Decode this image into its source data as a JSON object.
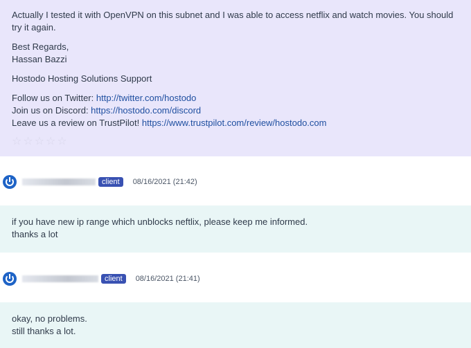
{
  "staff_reply": {
    "body": "Actually I tested it with OpenVPN on this subnet and I was able to access netflix and watch movies. You should try it again.",
    "regards": "Best Regards,",
    "signer": "Hassan Bazzi",
    "company": "Hostodo Hosting Solutions Support",
    "twitter_prefix": "Follow us on Twitter: ",
    "twitter_link": "http://twitter.com/hostodo",
    "discord_prefix": "Join us on Discord: ",
    "discord_link": "https://hostodo.com/discord",
    "review_prefix": "Leave us a review on TrustPilot! ",
    "review_link": "https://www.trustpilot.com/review/hostodo.com",
    "rating": {
      "value": 0,
      "max": 5,
      "icon": "star-outline-icon"
    }
  },
  "messages": [
    {
      "badge": "client",
      "date": "08/16/2021 (21:42)",
      "lines": [
        "if you have new ip range which unblocks neftlix, please keep me informed.",
        "thanks a lot"
      ]
    },
    {
      "badge": "client",
      "date": "08/16/2021 (21:41)",
      "lines": [
        "okay, no problems.",
        "still thanks a lot."
      ]
    }
  ],
  "colors": {
    "staff_bg": "#e9e6fb",
    "client_bg": "#e9f6f6",
    "badge_bg": "#3951b2",
    "link": "#1f4fa0",
    "avatar": "#1e63c6"
  }
}
